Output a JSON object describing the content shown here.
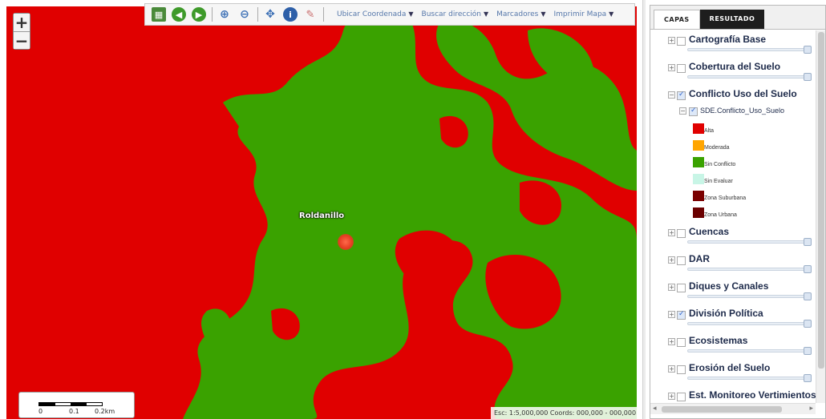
{
  "colors": {
    "conflict_high": "#e00000",
    "moderate": "#ffa500",
    "no_conflict": "#3aa200",
    "not_evaluated": "#c8f5e6",
    "suburban_zone": "#7a0000",
    "urban_zone": "#6b0000"
  },
  "map": {
    "zoom_in": "+",
    "zoom_out": "−",
    "place_label": "Roldanillo",
    "scale_ticks": [
      "0",
      "0.1",
      "0.2km"
    ],
    "coords_text": "Esc: 1:5,000,000   Coords: 000,000 - 000,000"
  },
  "toolbar": {
    "icons": [
      "map-extent-icon",
      "back-icon",
      "forward-icon",
      "zoom-in-icon",
      "zoom-out-icon",
      "pan-icon",
      "info-icon",
      "eraser-icon"
    ],
    "menus": [
      {
        "label": "Ubicar Coordenada"
      },
      {
        "label": "Buscar dirección"
      },
      {
        "label": "Marcadores"
      },
      {
        "label": "Imprimir Mapa"
      }
    ]
  },
  "panel": {
    "tabs": [
      {
        "label": "CAPAS",
        "active": true
      },
      {
        "label": "RESULTADO",
        "active": false
      }
    ],
    "layers": [
      {
        "name": "Cartografía Base",
        "checked": false
      },
      {
        "name": "Cobertura del Suelo",
        "checked": false
      },
      {
        "name": "Conflicto Uso del Suelo",
        "checked": true
      },
      {
        "name": "Cuencas",
        "checked": false
      },
      {
        "name": "DAR",
        "checked": false
      },
      {
        "name": "Diques y Canales",
        "checked": false
      },
      {
        "name": "División Política",
        "checked": true
      },
      {
        "name": "Ecosistemas",
        "checked": false
      },
      {
        "name": "Erosión del Suelo",
        "checked": false
      },
      {
        "name": "Est. Monitoreo Vertimientos",
        "checked": false
      }
    ],
    "sublayer": "SDE.Conflicto_Uso_Suelo",
    "legend": [
      {
        "label": "Alta"
      },
      {
        "label": "Moderada"
      },
      {
        "label": "Sin Conflicto"
      },
      {
        "label": "Sin Evaluar"
      },
      {
        "label": "Zona Suburbana"
      },
      {
        "label": "Zona Urbana"
      }
    ]
  }
}
